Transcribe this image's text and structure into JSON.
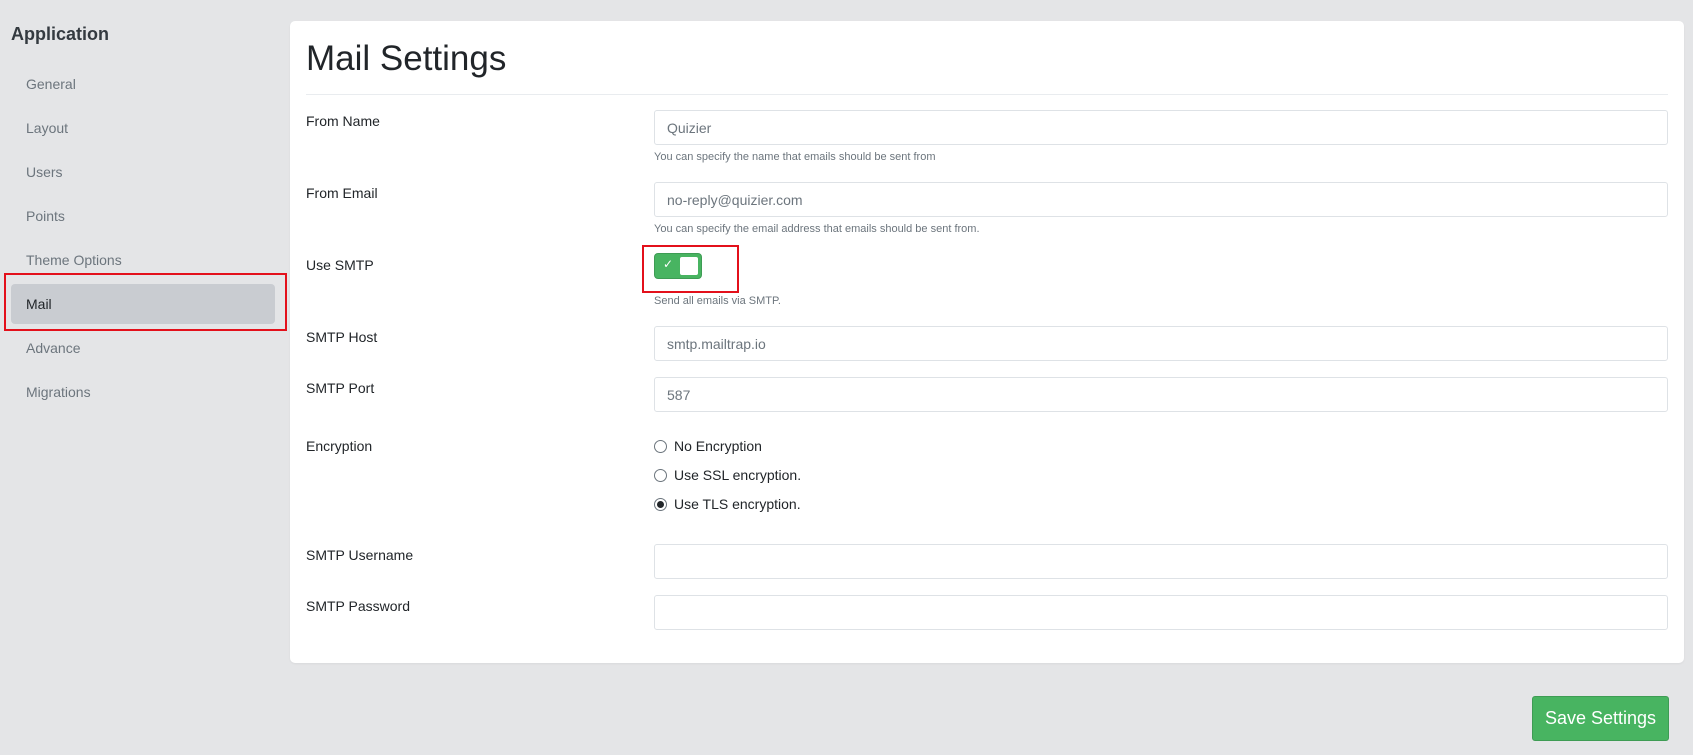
{
  "sidebar": {
    "title": "Application",
    "items": [
      {
        "label": "General"
      },
      {
        "label": "Layout"
      },
      {
        "label": "Users"
      },
      {
        "label": "Points"
      },
      {
        "label": "Theme Options"
      },
      {
        "label": "Mail"
      },
      {
        "label": "Advance"
      },
      {
        "label": "Migrations"
      }
    ],
    "active": "Mail"
  },
  "main": {
    "title": "Mail Settings",
    "fields": {
      "from_name": {
        "label": "From Name",
        "value": "Quizier",
        "help": "You can specify the name that emails should be sent from"
      },
      "from_email": {
        "label": "From Email",
        "value": "no-reply@quizier.com",
        "help": "You can specify the email address that emails should be sent from."
      },
      "use_smtp": {
        "label": "Use SMTP",
        "checked": true,
        "help": "Send all emails via SMTP."
      },
      "smtp_host": {
        "label": "SMTP Host",
        "value": "smtp.mailtrap.io"
      },
      "smtp_port": {
        "label": "SMTP Port",
        "value": "587"
      },
      "encryption": {
        "label": "Encryption",
        "options": [
          "No Encryption",
          "Use SSL encryption.",
          "Use TLS encryption."
        ],
        "selected": "Use TLS encryption."
      },
      "smtp_username": {
        "label": "SMTP Username",
        "value": ""
      },
      "smtp_password": {
        "label": "SMTP Password",
        "value": ""
      }
    },
    "save_label": "Save Settings"
  },
  "colors": {
    "accent": "#48b461",
    "highlight": "#e3101b",
    "background": "#e4e5e7"
  },
  "icons": {
    "toggle_check": "✓"
  }
}
